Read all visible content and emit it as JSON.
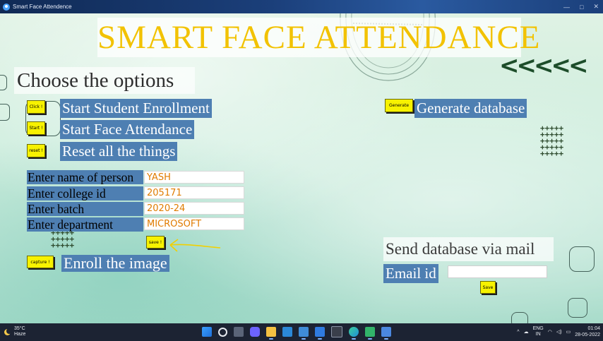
{
  "window": {
    "title": "Smart Face Attendence",
    "controls": [
      "—",
      "□",
      "✕"
    ]
  },
  "app": {
    "title": "SMART  FACE  ATTENDANCE",
    "chevrons": "<<<<<",
    "options_heading": "Choose the options",
    "buttons": {
      "click": "Click !",
      "start": "Start !",
      "reset": "reset !",
      "generate": "Generate",
      "save_form": "save !",
      "capture": "capture !",
      "save_mail": "Save"
    },
    "actions": {
      "enrollment": "Start Student Enrollment",
      "attendance": "Start Face Attendance",
      "reset": "Reset all the things",
      "generate": "Generate database",
      "enroll_image": "Enroll the image"
    },
    "form": {
      "fields": [
        {
          "label": "Enter name of person",
          "value": "YASH"
        },
        {
          "label": "Enter college id",
          "value": "205171"
        },
        {
          "label": "Enter batch",
          "value": "2020-24"
        },
        {
          "label": "Enter department",
          "value": "MICROSOFT"
        }
      ]
    },
    "mail": {
      "heading": "Send database via mail",
      "email_label": "Email id",
      "email_value": ""
    },
    "colors": {
      "title_text": "#f2c200",
      "label_bg": "#4e7fb2",
      "button_bg": "#f7f200",
      "input_text": "#e07b00"
    }
  },
  "taskbar": {
    "weather": {
      "temp": "35°C",
      "condition": "Haze"
    },
    "tray": {
      "language": "ENG",
      "region": "IN",
      "time": "01:04",
      "date": "28-05-2022"
    },
    "icons": [
      "windows-start-icon",
      "search-icon",
      "task-view-icon",
      "chat-icon",
      "file-explorer-icon",
      "calendar-icon",
      "store-icon",
      "vscode-icon",
      "terminal-icon",
      "edge-icon",
      "paint-icon",
      "app-icon"
    ]
  }
}
